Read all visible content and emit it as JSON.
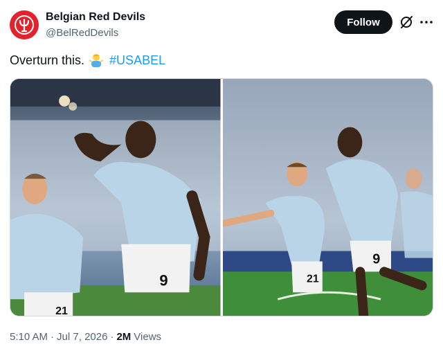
{
  "account": {
    "name": "Belgian Red Devils",
    "handle": "@BelRedDevils",
    "follow_label": "Follow"
  },
  "tweet": {
    "text": "Overturn this.",
    "emoji": "person-shrugging",
    "hashtag": "#USABEL"
  },
  "photos": [
    {
      "description_icon": "player-celebrating-photo",
      "jersey_numbers": [
        "9",
        "21"
      ]
    },
    {
      "description_icon": "players-running-celebration-photo",
      "jersey_numbers": [
        "9",
        "21",
        "9",
        "21"
      ]
    }
  ],
  "meta": {
    "time": "5:10 AM",
    "date": "Jul 7, 2026",
    "separator": "·",
    "views_count": "2M",
    "views_label": "Views"
  },
  "colors": {
    "brand_red": "#e3222b",
    "link_blue": "#1d9bf0",
    "text": "#0f1419",
    "muted": "#536471"
  }
}
